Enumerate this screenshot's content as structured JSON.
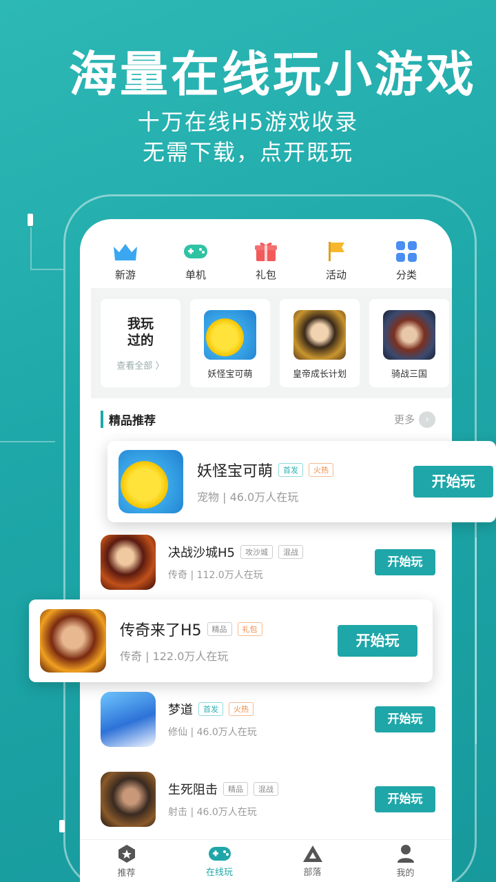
{
  "hero": {
    "headline": "海量在线玩小游戏",
    "sub1": "十万在线H5游戏收录",
    "sub2": "无需下载，点开既玩"
  },
  "topnav": [
    {
      "label": "新游",
      "icon": "crown-icon",
      "color": "#3aa7f0"
    },
    {
      "label": "单机",
      "icon": "gamepad-icon",
      "color": "#2fc3a4"
    },
    {
      "label": "礼包",
      "icon": "gift-icon",
      "color": "#f25a5a"
    },
    {
      "label": "活动",
      "icon": "flag-icon",
      "color": "#f6b72c"
    },
    {
      "label": "分类",
      "icon": "grid-icon",
      "color": "#4a8ef2"
    }
  ],
  "played": {
    "title": "我玩过的",
    "title_line1": "我玩",
    "title_line2": "过的",
    "more": "查看全部 〉",
    "games": [
      {
        "name": "妖怪宝可萌",
        "icon": "pikachu-icon"
      },
      {
        "name": "皇帝成长计划",
        "icon": "emperor-icon"
      },
      {
        "name": "骑战三国",
        "icon": "warrior-icon"
      }
    ]
  },
  "section": {
    "title": "精品推荐",
    "more": "更多"
  },
  "games": [
    {
      "name": "妖怪宝可萌",
      "tags": [
        "首发",
        "火热"
      ],
      "meta": "宠物 | 46.0万人在玩",
      "button": "开始玩"
    },
    {
      "name": "决战沙城H5",
      "tags": [
        "攻沙城",
        "混战"
      ],
      "meta": "传奇 | 112.0万人在玩",
      "button": "开始玩"
    },
    {
      "name": "传奇来了H5",
      "tags": [
        "精品",
        "礼包"
      ],
      "meta": "传奇 | 122.0万人在玩",
      "button": "开始玩"
    },
    {
      "name": "梦道",
      "tags": [
        "首发",
        "火热"
      ],
      "meta": "修仙 | 46.0万人在玩",
      "button": "开始玩"
    },
    {
      "name": "生死阻击",
      "tags": [
        "精品",
        "混战"
      ],
      "meta": "射击 | 46.0万人在玩",
      "button": "开始玩"
    }
  ],
  "tabbar": [
    {
      "label": "推荐",
      "icon": "hexagon-star-icon"
    },
    {
      "label": "在线玩",
      "icon": "gamepad-icon",
      "active": true
    },
    {
      "label": "部落",
      "icon": "triangle-icon"
    },
    {
      "label": "我的",
      "icon": "user-icon"
    }
  ],
  "colors": {
    "accent": "#1fa6a8",
    "background": "#2db8b5"
  }
}
